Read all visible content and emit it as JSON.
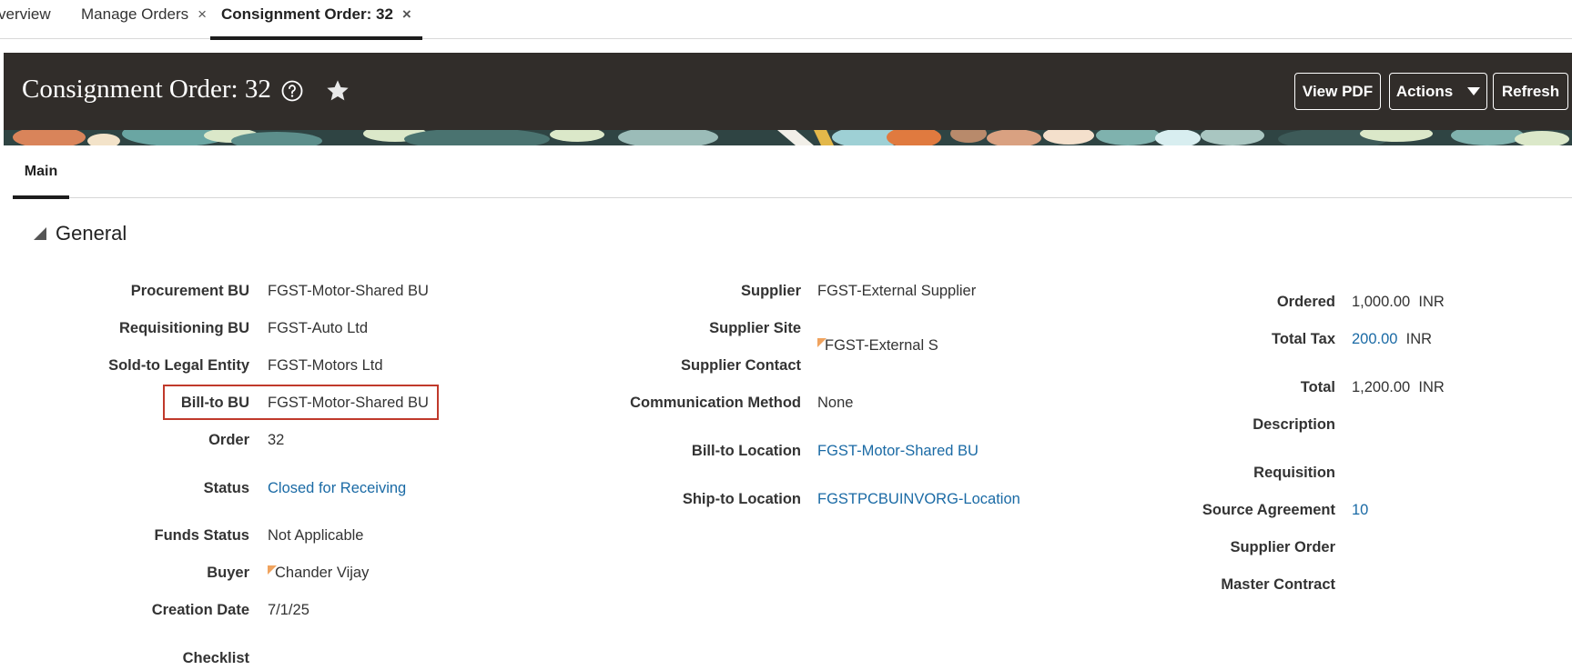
{
  "tabs": [
    {
      "label": "Overview",
      "shown": "verview",
      "closable": false,
      "active": false
    },
    {
      "label": "Manage Orders",
      "closable": true,
      "active": false
    },
    {
      "label": "Consignment Order: 32",
      "closable": true,
      "active": true
    }
  ],
  "tab_close_glyph": "×",
  "header": {
    "title": "Consignment Order: 32",
    "buttons": {
      "view_pdf": "View PDF",
      "actions": "Actions",
      "refresh": "Refresh"
    },
    "banner_color": "#312d2a"
  },
  "subtabs": {
    "main": "Main"
  },
  "section": {
    "title": "General"
  },
  "general": {
    "col1": {
      "procurement_bu": {
        "label": "Procurement BU",
        "value": "FGST-Motor-Shared BU"
      },
      "requisitioning_bu": {
        "label": "Requisitioning BU",
        "value": "FGST-Auto Ltd"
      },
      "sold_to": {
        "label": "Sold-to Legal Entity",
        "value": "FGST-Motors Ltd"
      },
      "bill_to_bu": {
        "label": "Bill-to BU",
        "value": "FGST-Motor-Shared BU"
      },
      "order": {
        "label": "Order",
        "value": "32"
      },
      "status": {
        "label": "Status",
        "value": "Closed for Receiving"
      },
      "funds_status": {
        "label": "Funds Status",
        "value": "Not Applicable"
      },
      "buyer": {
        "label": "Buyer",
        "value": "Chander Vijay"
      },
      "creation_date": {
        "label": "Creation Date",
        "value": "7/1/25"
      },
      "checklist": {
        "label": "Checklist",
        "value": ""
      }
    },
    "col2": {
      "supplier": {
        "label": "Supplier",
        "value": "FGST-External Supplier"
      },
      "supplier_site": {
        "label": "Supplier Site",
        "value": "FGST-External S"
      },
      "supplier_contact": {
        "label": "Supplier Contact",
        "value": ""
      },
      "communication_method": {
        "label": "Communication Method",
        "value": "None"
      },
      "bill_to_location": {
        "label": "Bill-to Location",
        "value": "FGST-Motor-Shared BU"
      },
      "ship_to_location": {
        "label": "Ship-to Location",
        "value": "FGSTPCBUINVORG-Location"
      }
    },
    "col3": {
      "ordered": {
        "label": "Ordered",
        "value": "1,000.00",
        "currency": "INR"
      },
      "total_tax": {
        "label": "Total Tax",
        "value": "200.00",
        "currency": "INR"
      },
      "total": {
        "label": "Total",
        "value": "1,200.00",
        "currency": "INR"
      },
      "description": {
        "label": "Description",
        "value": ""
      },
      "requisition": {
        "label": "Requisition",
        "value": ""
      },
      "source_agreement": {
        "label": "Source Agreement",
        "value": "10"
      },
      "supplier_order": {
        "label": "Supplier Order",
        "value": ""
      },
      "master_contract": {
        "label": "Master Contract",
        "value": ""
      }
    }
  },
  "colors": {
    "link": "#1a6aa5",
    "highlight_border": "#c0392b",
    "flag": "#f0a35e"
  }
}
